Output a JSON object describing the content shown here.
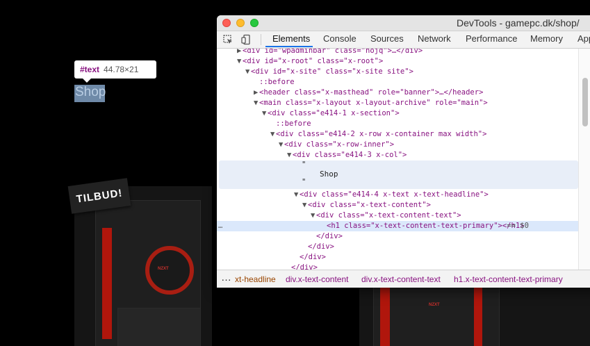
{
  "page": {
    "tooltip": {
      "tag": "#text",
      "dimensions": "44.78×21"
    },
    "heading": "Shop",
    "badge": "TILBUD!"
  },
  "devtools": {
    "title": "DevTools - gamepc.dk/shop/",
    "tabs": [
      {
        "label": "Elements",
        "active": true
      },
      {
        "label": "Console"
      },
      {
        "label": "Sources"
      },
      {
        "label": "Network"
      },
      {
        "label": "Performance"
      },
      {
        "label": "Memory"
      },
      {
        "label": "App"
      }
    ],
    "dom": {
      "l0": "<div id=\"wpadminbar\" class=\"nojq\">…</div>",
      "l1": "<div id=\"x-root\" class=\"x-root\">",
      "l2": "<div id=\"x-site\" class=\"x-site site\">",
      "l3": "::before",
      "l4": "<header class=\"x-masthead\" role=\"banner\">…</header>",
      "l5": "<main class=\"x-layout x-layout-archive\" role=\"main\">",
      "l6": "<div class=\"e414-1 x-section\">",
      "l7": "::before",
      "l8": "<div class=\"e414-2 x-row x-container max width\">",
      "l9": "<div class=\"x-row-inner\">",
      "l10": "<div class=\"e414-3 x-col\">",
      "text_quote": "\"",
      "text_value": "Shop",
      "l11": "<div class=\"e414-4 x-text x-text-headline\">",
      "l12": "<div class=\"x-text-content\">",
      "l13": "<div class=\"x-text-content-text\">",
      "l14": "<h1 class=\"x-text-content-text-primary\"></h1>",
      "l14_suffix": " == $0",
      "l15": "</div>",
      "l16": "</div>",
      "l17": "</div>",
      "l18": "</div>",
      "ellipsis": "…"
    },
    "breadcrumbs": [
      "xt-headline",
      "div.x-text-content",
      "div.x-text-content-text",
      "h1.x-text-content-text-primary"
    ],
    "breadcrumb_more": "…"
  }
}
